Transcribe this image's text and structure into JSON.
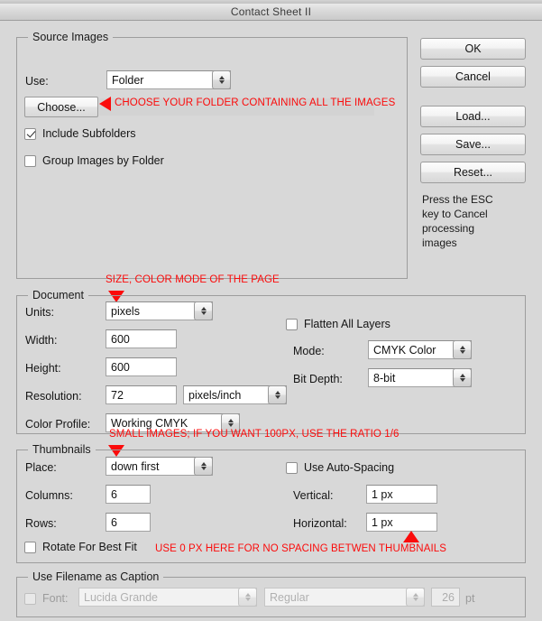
{
  "window": {
    "title": "Contact Sheet II"
  },
  "source_images": {
    "legend": "Source Images",
    "use_label": "Use:",
    "use_value": "Folder",
    "choose_button": "Choose...",
    "include_subfolders": "Include Subfolders",
    "group_images_by_folder": "Group Images by Folder"
  },
  "buttons": {
    "ok": "OK",
    "cancel": "Cancel",
    "load": "Load...",
    "save": "Save...",
    "reset": "Reset...",
    "esc_note": "Press the ESC key to Cancel processing images"
  },
  "document": {
    "legend": "Document",
    "units_label": "Units:",
    "units_value": "pixels",
    "width_label": "Width:",
    "width_value": "600",
    "height_label": "Height:",
    "height_value": "600",
    "resolution_label": "Resolution:",
    "resolution_value": "72",
    "resolution_units": "pixels/inch",
    "color_profile_label": "Color Profile:",
    "color_profile_value": "Working CMYK",
    "flatten_all_layers": "Flatten All Layers",
    "mode_label": "Mode:",
    "mode_value": "CMYK Color",
    "bit_depth_label": "Bit Depth:",
    "bit_depth_value": "8-bit"
  },
  "thumbnails": {
    "legend": "Thumbnails",
    "place_label": "Place:",
    "place_value": "down first",
    "columns_label": "Columns:",
    "columns_value": "6",
    "rows_label": "Rows:",
    "rows_value": "6",
    "rotate_for_best_fit": "Rotate For Best Fit",
    "use_auto_spacing": "Use Auto-Spacing",
    "vertical_label": "Vertical:",
    "vertical_value": "1 px",
    "horizontal_label": "Horizontal:",
    "horizontal_value": "1 px"
  },
  "caption": {
    "legend": "Use Filename as Caption",
    "font_label": "Font:",
    "font_value": "Lucida Grande",
    "style_value": "Regular",
    "size_value": "26",
    "size_units": "pt"
  },
  "annotations": {
    "choose_folder": "CHOOSE YOUR FOLDER CONTAINING ALL THE IMAGES",
    "document_size": "SIZE, COLOR MODE OF THE PAGE",
    "thumbnail_ratio": "SMALL IMAGES; IF YOU WANT 100PX, USE THE RATIO 1/6",
    "spacing": "USE 0 PX HERE FOR NO SPACING BETWEN THUMBNAILS"
  },
  "colors": {
    "annotation_red": "#fb0b0b",
    "dialog_bg": "#d8d8d8"
  }
}
